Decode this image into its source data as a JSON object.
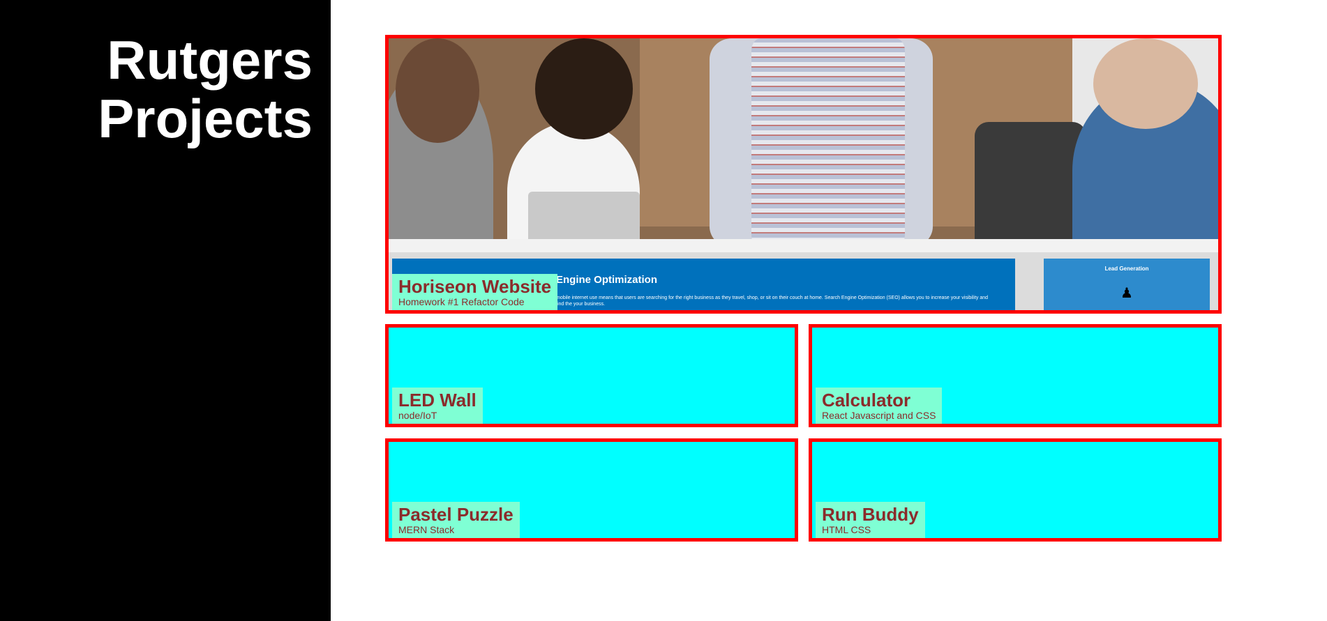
{
  "sidebar": {
    "title_line1": "Rutgers",
    "title_line2": "Projects"
  },
  "featured": {
    "title": "Horiseon Website",
    "subtitle": "Homework #1 Refactor Code",
    "preview": {
      "band_title": "Engine Optimization",
      "band_text": "mobile internet use means that users are searching for the right business as they travel, shop, or sit on their couch at home. Search Engine Optimization (SEO) allows you to increase your visibility and find the your business.",
      "side_title": "Lead Generation",
      "side_icon": "lightbulb-icon"
    }
  },
  "projects": [
    {
      "title": "LED Wall",
      "subtitle": "node/IoT"
    },
    {
      "title": "Calculator",
      "subtitle": "React Javascript and CSS"
    },
    {
      "title": "Pastel Puzzle",
      "subtitle": "MERN Stack"
    },
    {
      "title": "Run Buddy",
      "subtitle": "HTML CSS"
    }
  ],
  "colors": {
    "sidebar_bg": "#000000",
    "card_border": "#ff0000",
    "card_bg": "#00ffff",
    "caption_bg": "#7fffd4",
    "caption_text": "#8b2b2b"
  }
}
